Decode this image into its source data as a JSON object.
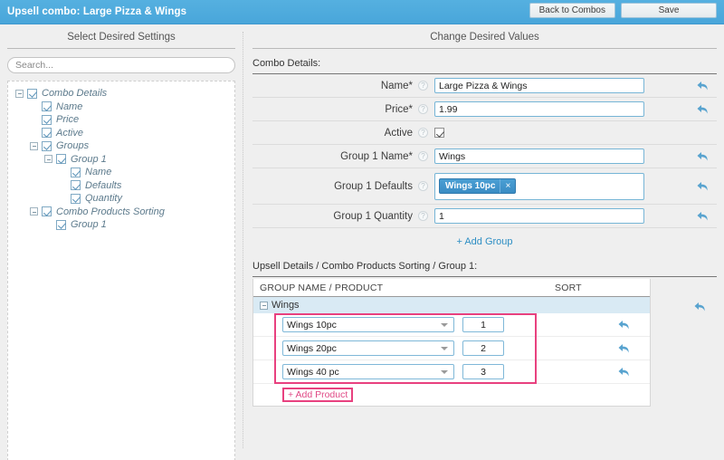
{
  "titlebar": {
    "title": "Upsell combo: Large Pizza & Wings",
    "back_label": "Back to Combos",
    "save_label": "Save"
  },
  "colors": {
    "header_blue": "#49a6da",
    "tag_blue": "#3a8cc4",
    "highlight_pink": "#e8417f",
    "link_blue": "#2d8ec4",
    "group_row_blue": "#d9eaf4"
  },
  "left_pane": {
    "title": "Select Desired Settings",
    "search_placeholder": "Search...",
    "search_value": "",
    "tree": [
      {
        "label": "Combo Details",
        "indent": 0,
        "expander": "minus",
        "checked": true
      },
      {
        "label": "Name",
        "indent": 1,
        "expander": "none",
        "checked": true
      },
      {
        "label": "Price",
        "indent": 1,
        "expander": "none",
        "checked": true
      },
      {
        "label": "Active",
        "indent": 1,
        "expander": "none",
        "checked": true
      },
      {
        "label": "Groups",
        "indent": 1,
        "expander": "minus",
        "checked": true
      },
      {
        "label": "Group 1",
        "indent": 2,
        "expander": "minus",
        "checked": true
      },
      {
        "label": "Name",
        "indent": 3,
        "expander": "none",
        "checked": true
      },
      {
        "label": "Defaults",
        "indent": 3,
        "expander": "none",
        "checked": true
      },
      {
        "label": "Quantity",
        "indent": 3,
        "expander": "none",
        "checked": true
      },
      {
        "label": "Combo Products Sorting",
        "indent": 1,
        "expander": "minus",
        "checked": true
      },
      {
        "label": "Group 1",
        "indent": 2,
        "expander": "none",
        "checked": true
      }
    ]
  },
  "right_pane": {
    "title": "Change Desired Values",
    "section_label": "Combo Details:",
    "fields": [
      {
        "label": "Name*",
        "type": "text",
        "value": "Large Pizza & Wings",
        "help": "?",
        "undo": true
      },
      {
        "label": "Price*",
        "type": "text",
        "value": "1.99",
        "help": "?",
        "undo": true
      },
      {
        "label": "Active",
        "type": "checkbox",
        "checked": true,
        "help": "?",
        "undo": false
      },
      {
        "label": "Group 1 Name*",
        "type": "text",
        "value": "Wings",
        "help": "?",
        "undo": true
      },
      {
        "label": "Group 1 Defaults",
        "type": "tags",
        "tags": [
          {
            "text": "Wings 10pc",
            "remove": "×"
          }
        ],
        "help": "?",
        "undo": true
      },
      {
        "label": "Group 1 Quantity",
        "type": "text",
        "value": "1",
        "help": "?",
        "undo": true
      }
    ],
    "add_group_label": "+ Add Group",
    "sorting": {
      "section_label": "Upsell Details / Combo Products Sorting / Group 1:",
      "columns": [
        "GROUP NAME / PRODUCT",
        "SORT"
      ],
      "group_name": "Wings",
      "rows": [
        {
          "product": "Wings 10pc",
          "sort": "1"
        },
        {
          "product": "Wings 20pc",
          "sort": "2"
        },
        {
          "product": "Wings 40 pc",
          "sort": "3"
        }
      ],
      "add_product_label": "+ Add Product"
    }
  }
}
